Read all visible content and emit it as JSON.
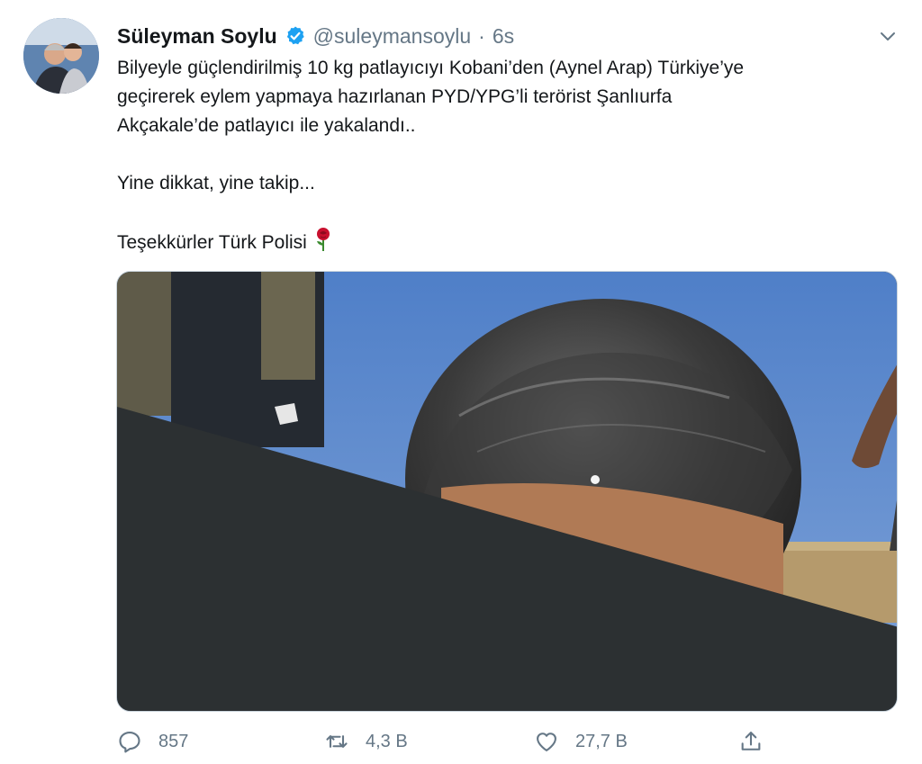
{
  "tweet": {
    "author": {
      "name": "Süleyman Soylu",
      "handle": "@suleymansoylu",
      "separator": "·",
      "time": "6s"
    },
    "text": {
      "line1": "Bilyeyle güçlendirilmiş 10 kg patlayıcıyı Kobani’den (Aynel Arap) Türkiye’ye",
      "line2": "geçirerek eylem yapmaya hazırlanan PYD/YPG’li terörist Şanlıurfa",
      "line3": "Akçakale’de patlayıcı ile yakalandı..",
      "line4": "Yine dikkat, yine takip...",
      "line5": "Teşekkürler Türk Polisi"
    },
    "stats": {
      "replies": "857",
      "retweets": "4,3 B",
      "likes": "27,7 B"
    }
  },
  "icons": {
    "verified": "verified-badge-icon",
    "menu": "chevron-down-icon",
    "emoji": "rose-icon",
    "reply": "reply-icon",
    "retweet": "retweet-icon",
    "like": "heart-icon",
    "share": "share-icon"
  },
  "colors": {
    "verified_blue": "#1da1f2",
    "secondary_text": "#657786",
    "primary_text": "#14171a"
  }
}
